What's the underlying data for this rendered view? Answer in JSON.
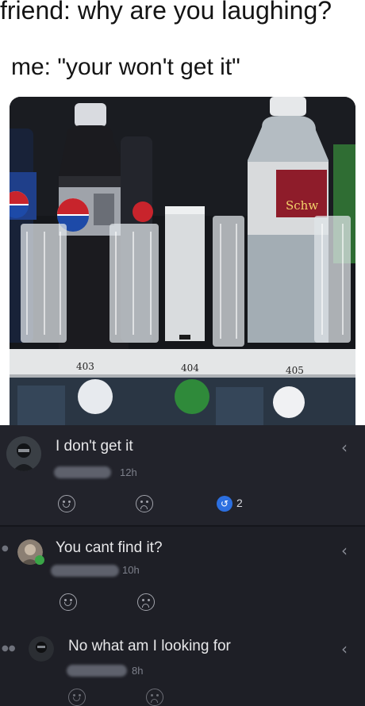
{
  "meme": {
    "line1": "friend: why are you laughing?",
    "line2": "me: \"your won't get it\"",
    "slot_labels": [
      "403",
      "404",
      "405"
    ],
    "label_brand": "Schw"
  },
  "comments": [
    {
      "text": "I don't get it",
      "time": "12h",
      "reply_count": "2"
    },
    {
      "text": "You cant find it?",
      "time": "10h"
    },
    {
      "text": "No what am I looking for",
      "time": "8h"
    }
  ],
  "icons": {
    "reply": "reply-arrow-icon",
    "react": "smile-face-icon",
    "dislike": "frown-face-icon",
    "replies": "replies-badge-icon"
  },
  "colors": {
    "comment_bg": "#22232b",
    "panel_bg": "#1e1f26",
    "badge": "#2c6fe0"
  }
}
